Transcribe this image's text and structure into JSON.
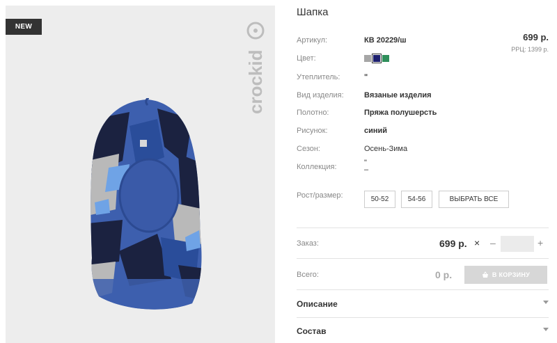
{
  "badge": "NEW",
  "brand": "crockid",
  "product": {
    "title": "Шапка",
    "price": "699 р.",
    "rrp": "РРЦ: 1399 р."
  },
  "details": {
    "article": {
      "label": "Артикул:",
      "value": "КВ 20229/ш"
    },
    "color": {
      "label": "Цвет:",
      "swatches": [
        "#a6a6a6",
        "#1c1f6e",
        "#2f8f5b"
      ],
      "selected_index": 1
    },
    "insulation": {
      "label": "Утеплитель:",
      "value": "\""
    },
    "type": {
      "label": "Вид изделия:",
      "value": "Вязаные изделия"
    },
    "fabric": {
      "label": "Полотно:",
      "value": "Пряжа полушерсть"
    },
    "pattern": {
      "label": "Рисунок:",
      "value": "синий"
    },
    "season": {
      "label": "Сезон:",
      "value": "Осень-Зима"
    },
    "collection": {
      "label": "Коллекция:",
      "value": "\"",
      "value2": "–"
    }
  },
  "sizes": {
    "label": "Рост/размер:",
    "options": [
      "50-52",
      "54-56"
    ],
    "select_all": "ВЫБРАТЬ ВСЕ"
  },
  "order": {
    "label": "Заказ:",
    "price": "699 р.",
    "times": "×",
    "minus": "–",
    "plus": "+",
    "quantity": ""
  },
  "total": {
    "label": "Всего:",
    "value": "0 р.",
    "cart_button": "В КОРЗИНУ"
  },
  "accordion": {
    "description": "Описание",
    "composition": "Состав"
  }
}
